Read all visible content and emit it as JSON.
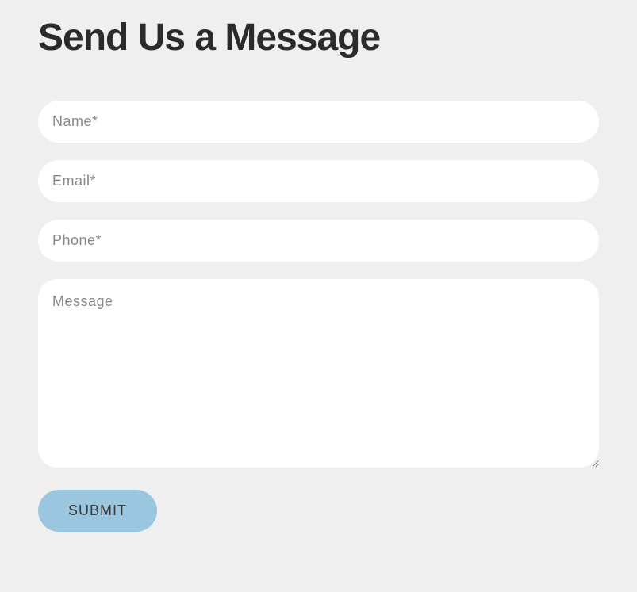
{
  "heading": "Send Us a Message",
  "form": {
    "name_placeholder": "Name*",
    "email_placeholder": "Email*",
    "phone_placeholder": "Phone*",
    "message_placeholder": "Message",
    "submit_label": "SUBMIT"
  }
}
